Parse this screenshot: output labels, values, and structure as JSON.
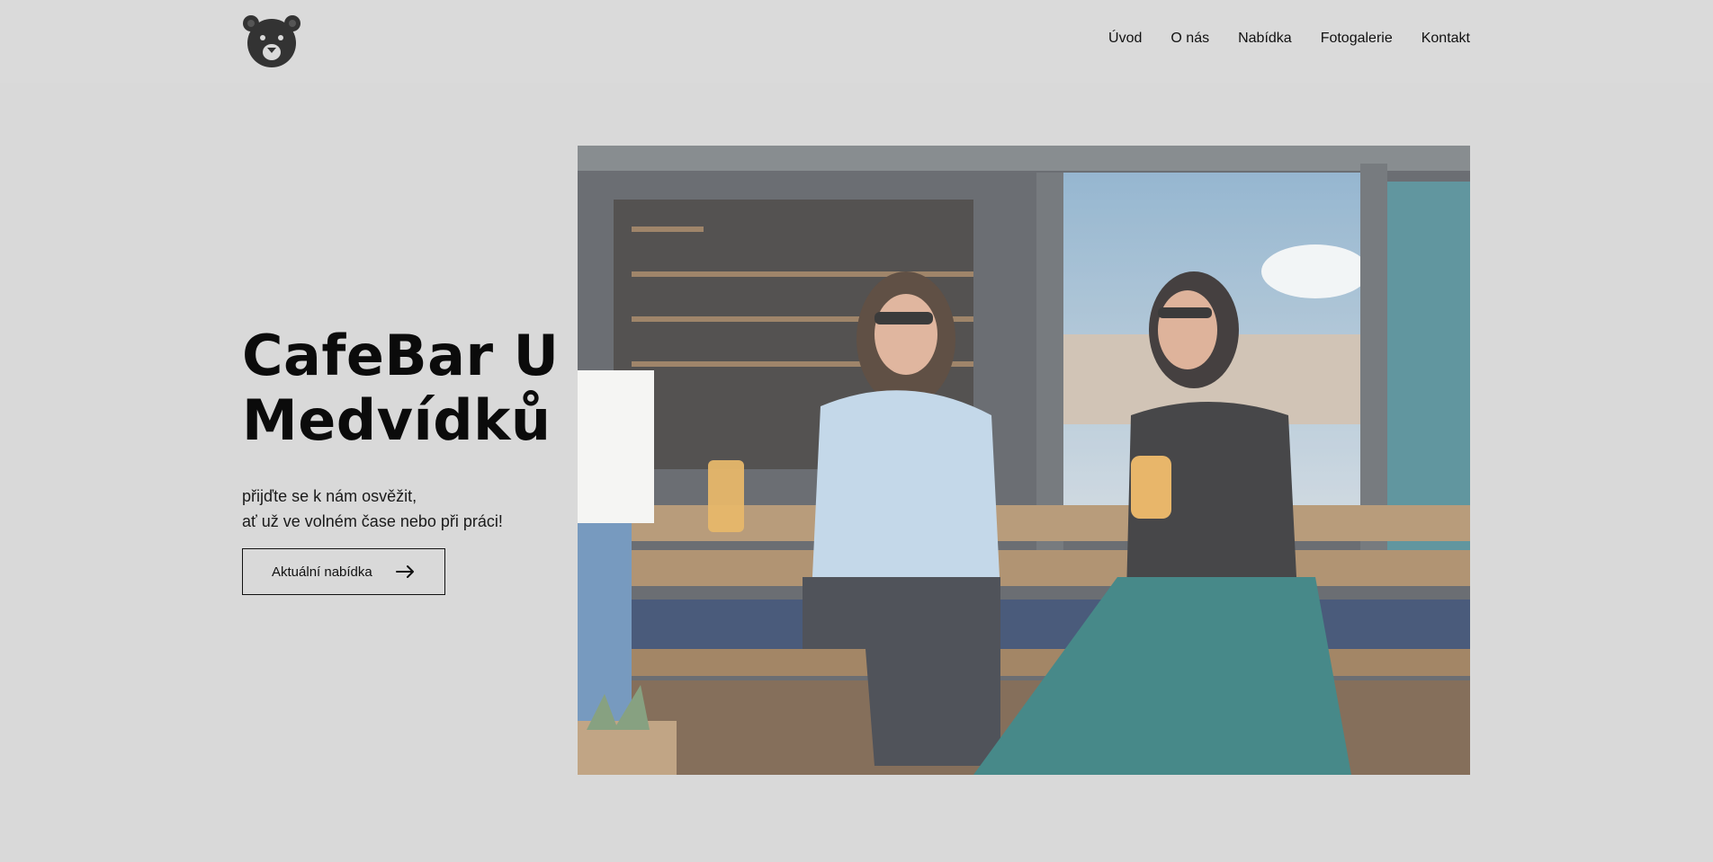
{
  "header": {
    "logo_icon": "bear-head-icon",
    "nav": [
      {
        "label": "Úvod"
      },
      {
        "label": "O nás"
      },
      {
        "label": "Nabídka"
      },
      {
        "label": "Fotogalerie"
      },
      {
        "label": "Kontakt"
      }
    ]
  },
  "hero": {
    "title_line1": "CafeBar U",
    "title_line2": "Medvídků",
    "subtitle_line1": "přijďte se k nám osvěžit,",
    "subtitle_line2": "ať už ve volném čase nebo při práci!",
    "cta_label": "Aktuální nabídka",
    "cta_icon": "arrow-right-icon"
  },
  "photo": {
    "description_icon": "hero-photo"
  },
  "colors": {
    "background": "#d9d9d9",
    "text": "#111111",
    "logo": "#333333"
  }
}
